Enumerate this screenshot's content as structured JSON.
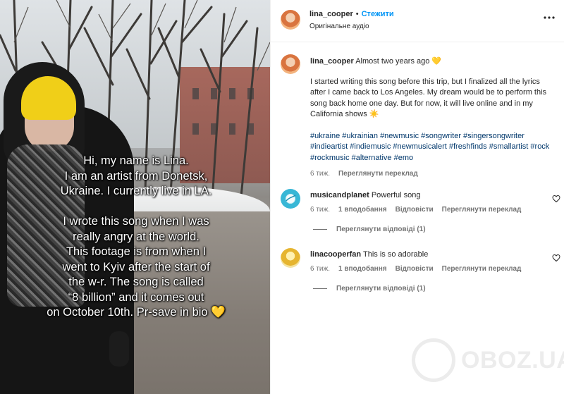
{
  "video": {
    "overlay_text": "Hi, my name is Lina.\nI am an artist from Donetsk,\nUkraine. I currently live in LA.\n\nI wrote this song when I was\nreally angry at the world.\nThis footage is from when I\nwent to Kyiv after the start of\nthe w-r. The song is called\n“8 billion” and it comes out\non October 10th. Pr-save in bio 💛"
  },
  "header": {
    "username": "lina_cooper",
    "separator": "•",
    "follow_label": "Стежити",
    "audio_label": "Оригінальне аудіо",
    "more_icon": "more-horizontal-icon"
  },
  "caption": {
    "username": "lina_cooper",
    "time_text": "Almost two years ago 💛",
    "body": "I started writing this song before this trip, but I finalized all the lyrics after I came back to Los Angeles. My dream would be to perform this song back home one day. But for now, it will live online and in my California shows ☀️",
    "hashtags": "#ukraine #ukrainian #newmusic #songwriter #singersongwriter #indieartist #indiemusic #newmusicalert #freshfinds #smallartist #rock #rockmusic #alternative #emo",
    "age": "6 тиж.",
    "translate_label": "Переглянути переклад"
  },
  "comments": [
    {
      "username": "musicandplanet",
      "text": "Powerful song",
      "age": "6 тиж.",
      "likes": "1 вподобання",
      "reply_label": "Відповісти",
      "translate_label": "Переглянути переклад",
      "view_replies": "Переглянути відповіді (1)"
    },
    {
      "username": "linacooperfan",
      "text": "This is so adorable",
      "age": "6 тиж.",
      "likes": "1 вподобання",
      "reply_label": "Відповісти",
      "translate_label": "Переглянути переклад",
      "view_replies": "Переглянути відповіді (1)"
    }
  ],
  "watermark": {
    "text": "OBOZ.UA"
  },
  "colors": {
    "follow": "#0095f6",
    "hashtag": "#00376b",
    "meta": "#737373",
    "hat": "#f0cf18"
  }
}
